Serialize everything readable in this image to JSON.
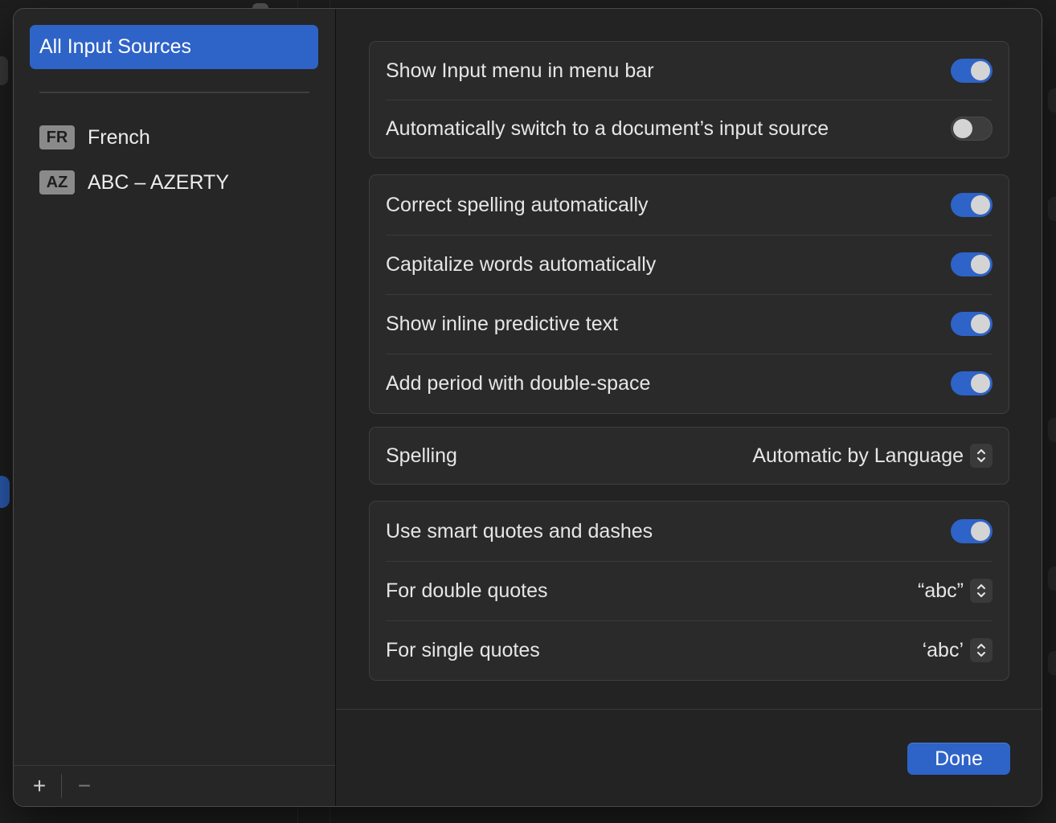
{
  "sidebar": {
    "header": "All Input Sources",
    "sources": [
      {
        "badge": "FR",
        "label": "French"
      },
      {
        "badge": "AZ",
        "label": "ABC – AZERTY"
      }
    ],
    "add_label": "+",
    "remove_label": "−"
  },
  "groups": {
    "menu": {
      "show_input_menu": {
        "label": "Show Input menu in menu bar",
        "on": true
      },
      "auto_switch": {
        "label": "Automatically switch to a document’s input source",
        "on": false
      }
    },
    "typing": {
      "correct_spelling": {
        "label": "Correct spelling automatically",
        "on": true
      },
      "capitalize": {
        "label": "Capitalize words automatically",
        "on": true
      },
      "predictive": {
        "label": "Show inline predictive text",
        "on": true
      },
      "period": {
        "label": "Add period with double-space",
        "on": true
      }
    },
    "spelling": {
      "label": "Spelling",
      "value": "Automatic by Language"
    },
    "quotes": {
      "smart_quotes": {
        "label": "Use smart quotes and dashes",
        "on": true
      },
      "double_quotes": {
        "label": "For double quotes",
        "value": "“abc”"
      },
      "single_quotes": {
        "label": "For single quotes",
        "value": "‘abc’"
      }
    }
  },
  "done_label": "Done",
  "colors": {
    "accent": "#2e63c8",
    "sheet": "#232323",
    "sidebar": "#262626"
  }
}
